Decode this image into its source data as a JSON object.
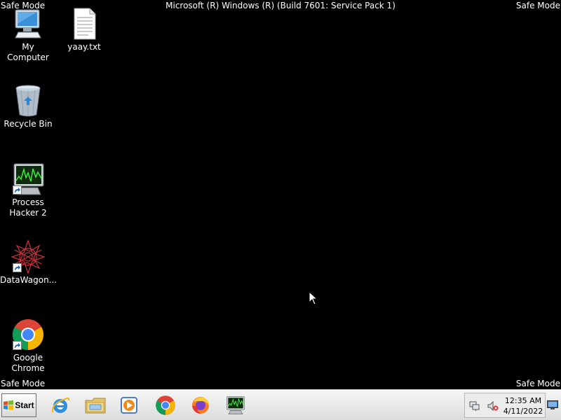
{
  "overlay": {
    "safe_mode_top_left": "Safe Mode",
    "safe_mode_top_right": "Safe Mode",
    "safe_mode_bottom_left": "Safe Mode",
    "safe_mode_bottom_right": "Safe Mode",
    "build_info": "Microsoft (R) Windows (R) (Build 7601: Service Pack 1)"
  },
  "desktop": {
    "background_color": "#000000",
    "icons": [
      {
        "label": "My Computer",
        "icon": "my-computer-icon"
      },
      {
        "label": "yaay.txt",
        "icon": "text-file-icon"
      },
      {
        "label": "Recycle Bin",
        "icon": "recycle-bin-icon"
      },
      {
        "label": "Process Hacker 2",
        "label_line1": "Process",
        "label_line2": "Hacker 2",
        "icon": "process-hacker-icon",
        "shortcut": true
      },
      {
        "label": "DataWagon...",
        "icon": "datawagon-icon",
        "shortcut": true
      },
      {
        "label": "Google Chrome",
        "label_line1": "Google",
        "label_line2": "Chrome",
        "icon": "chrome-icon",
        "shortcut": true
      }
    ]
  },
  "taskbar": {
    "start_label": "Start",
    "pinned": [
      {
        "icon": "internet-explorer-icon"
      },
      {
        "icon": "file-explorer-icon"
      },
      {
        "icon": "media-player-icon"
      },
      {
        "icon": "chrome-icon"
      },
      {
        "icon": "firefox-icon"
      },
      {
        "icon": "process-hacker-icon"
      }
    ],
    "tray": {
      "time": "12:35 AM",
      "date": "4/11/2022",
      "icons": [
        "network-icon",
        "volume-muted-icon",
        "show-desktop-icon"
      ]
    }
  }
}
